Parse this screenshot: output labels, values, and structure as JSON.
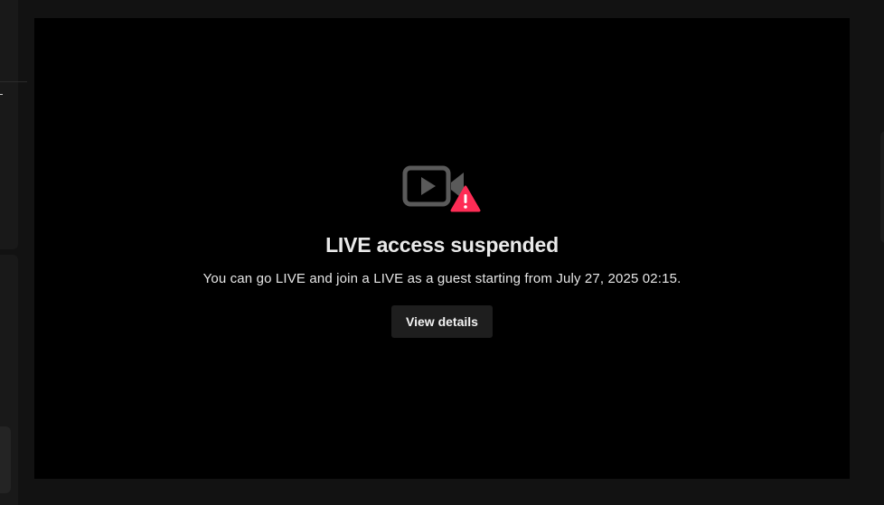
{
  "notice": {
    "icon": "video-camera-warning-icon",
    "title": "LIVE access suspended",
    "message": "You can go LIVE and join a LIVE as a guest starting from July 27, 2025 02:15.",
    "button_label": "View details"
  },
  "colors": {
    "background": "#121212",
    "video_background": "#000000",
    "icon_gray": "#5a5a5a",
    "warning_red": "#fe2c55",
    "button_background": "#1e1e1e"
  }
}
